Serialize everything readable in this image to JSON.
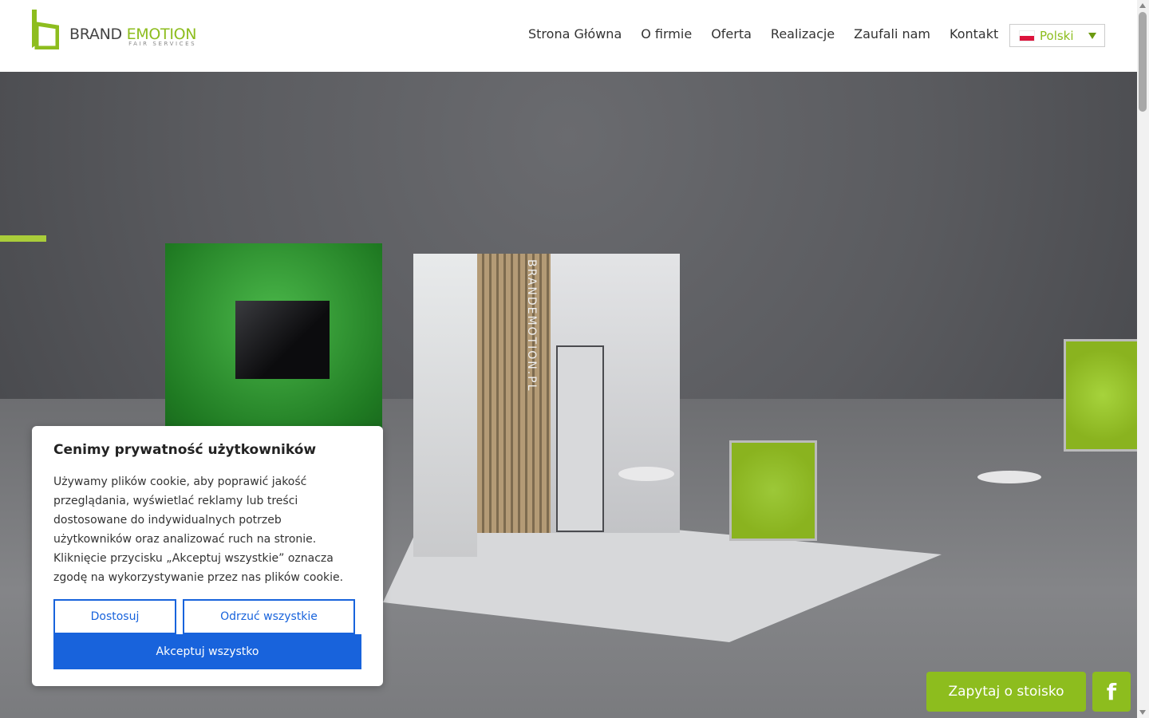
{
  "header": {
    "logo": {
      "brand": "BRAND",
      "emotion": "EMOTION",
      "sub": "FAIR SERVICES"
    },
    "nav": [
      "Strona Główna",
      "O firmie",
      "Oferta",
      "Realizacje",
      "Zaufali nam",
      "Kontakt"
    ],
    "language": {
      "selected": "Polski",
      "flag": "flag-pl-icon"
    }
  },
  "hero": {
    "wall_text": "BRANDEMOTION.PL"
  },
  "cookie": {
    "title": "Cenimy prywatność użytkowników",
    "body": "Używamy plików cookie, aby poprawić jakość przeglądania, wyświetlać reklamy lub treści dostosowane do indywidualnych potrzeb użytkowników oraz analizować ruch na stronie. Kliknięcie przycisku „Akceptuj wszystkie” oznacza zgodę na wykorzystywanie przez nas plików cookie.",
    "customize": "Dostosuj",
    "reject": "Odrzuć wszystkie",
    "accept": "Akceptuj wszystko"
  },
  "floating": {
    "ask": "Zapytaj o stoisko",
    "facebook_glyph": "f"
  },
  "colors": {
    "brand_green": "#8dbd1e",
    "cookie_blue": "#1863dc"
  }
}
